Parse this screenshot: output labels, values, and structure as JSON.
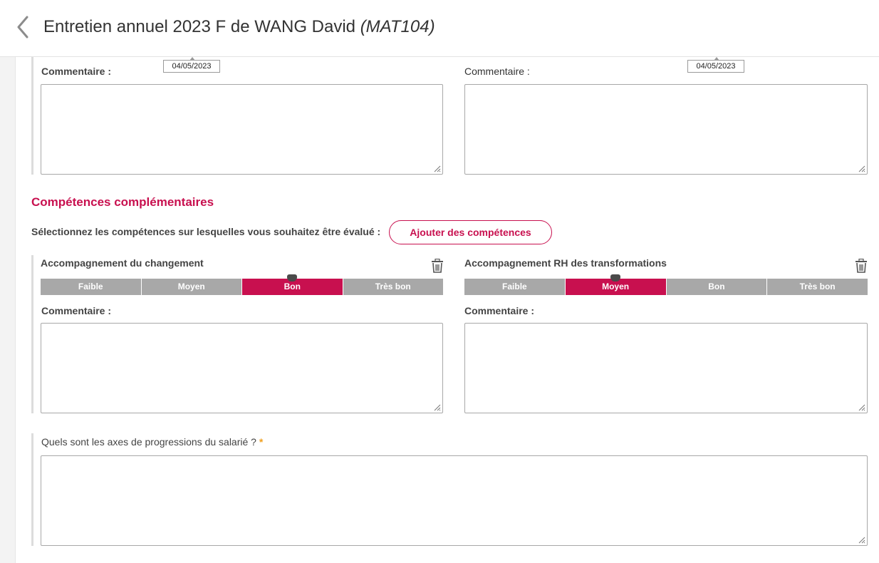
{
  "header": {
    "title": "Entretien annuel 2023 F de WANG David",
    "code": "(MAT104)"
  },
  "top_blocks": [
    {
      "comment_label": "Commentaire :",
      "date": "04/05/2023"
    },
    {
      "comment_label": "Commentaire :",
      "date": "04/05/2023"
    }
  ],
  "complementary": {
    "title": "Compétences complémentaires",
    "select_text": "Sélectionnez les compétences sur lesquelles vous souhaitez être évalué :",
    "add_button": "Ajouter des compétences",
    "skills": [
      {
        "name": "Accompagnement du changement",
        "levels": [
          "Faible",
          "Moyen",
          "Bon",
          "Très bon"
        ],
        "selected": "Bon",
        "comment_label": "Commentaire :"
      },
      {
        "name": "Accompagnement RH des transformations",
        "levels": [
          "Faible",
          "Moyen",
          "Bon",
          "Très bon"
        ],
        "selected": "Moyen",
        "comment_label": "Commentaire :"
      }
    ]
  },
  "progression": {
    "question": "Quels sont les axes de progressions du salarié ?",
    "required_mark": "*"
  },
  "colors": {
    "accent": "#c8104f",
    "segment_inactive": "#a8a8a8",
    "required": "#f0a020"
  },
  "icons": {
    "back": "chevron-left-icon",
    "delete": "trash-icon",
    "resize": "resize-grip-icon"
  }
}
